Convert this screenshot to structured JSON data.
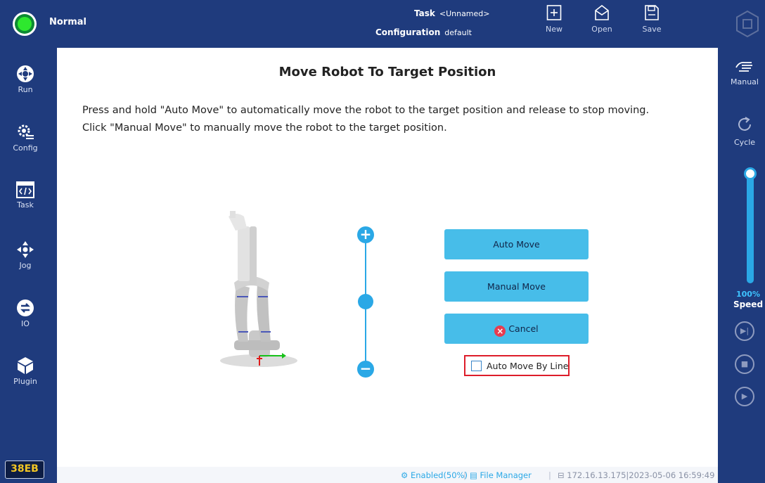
{
  "topbar": {
    "mode": "Normal",
    "task_label": "Task",
    "task_value": "<Unnamed>",
    "config_label": "Configuration",
    "config_value": "default",
    "buttons": {
      "new": "New",
      "open": "Open",
      "save": "Save"
    }
  },
  "nav": {
    "run": "Run",
    "config": "Config",
    "task": "Task",
    "jog": "Jog",
    "io": "IO",
    "plugin": "Plugin",
    "device_id": "38EB"
  },
  "main": {
    "title": "Move Robot To Target Position",
    "instructions": [
      "Press and hold \"Auto Move\" to automatically move the robot to the target position and release to stop moving.",
      "Click \"Manual Move\" to manually move the robot to the target position."
    ],
    "buttons": {
      "auto_move": "Auto Move",
      "manual_move": "Manual Move",
      "cancel": "Cancel"
    },
    "checkbox": {
      "label": "Auto Move By Line",
      "checked": false
    }
  },
  "right": {
    "manual": "Manual",
    "cycle": "Cycle",
    "speed_value": "100%",
    "speed_label": "Speed"
  },
  "statusbar": {
    "enabled": "Enabled(50%)",
    "file_manager": "File Manager",
    "ip_time": "172.16.13.175|2023-05-06 16:59:49"
  },
  "colors": {
    "bg": "#1f3b7d",
    "accent": "#2aa8e6",
    "button": "#47bde9",
    "highlight": "#dd1d2a"
  }
}
